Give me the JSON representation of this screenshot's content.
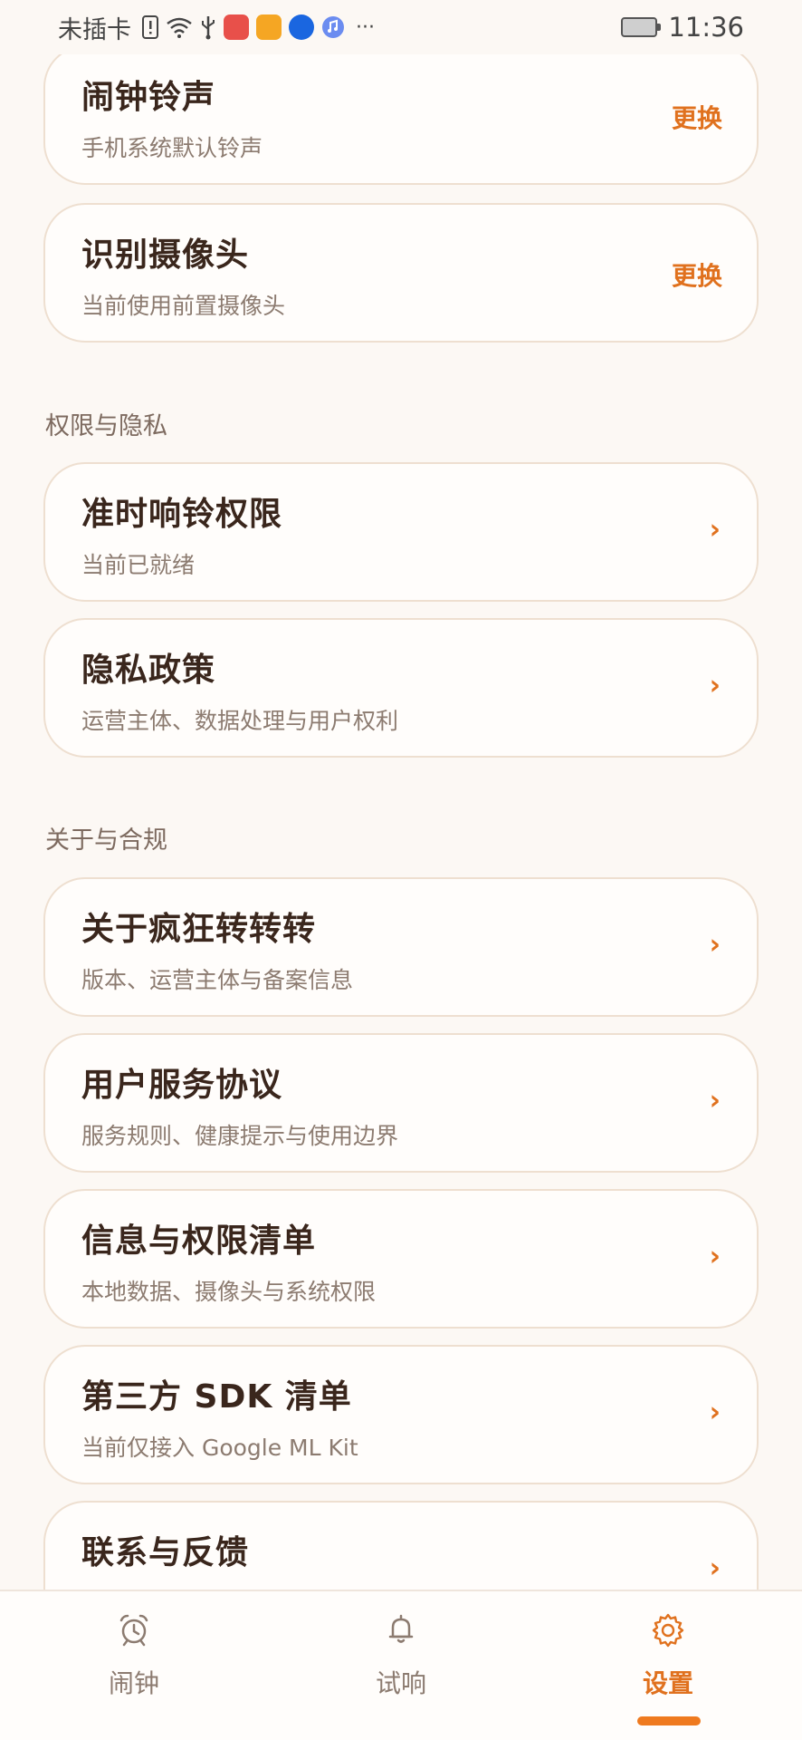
{
  "status_bar": {
    "carrier": "未插卡",
    "time": "11:36",
    "more": "···",
    "icons": [
      "sim-alert-icon",
      "wifi-icon",
      "usb-icon",
      "app-huawei-icon",
      "app-video-icon",
      "app-tips-icon",
      "music-icon",
      "battery-icon"
    ]
  },
  "cards": [
    {
      "title": "闹钟铃声",
      "subtitle": "手机系统默认铃声",
      "action": "更换"
    },
    {
      "title": "识别摄像头",
      "subtitle": "当前使用前置摄像头",
      "action": "更换"
    }
  ],
  "sections": [
    {
      "title": "权限与隐私",
      "items": [
        {
          "title": "准时响铃权限",
          "subtitle": "当前已就绪",
          "chevron": "›"
        },
        {
          "title": "隐私政策",
          "subtitle": "运营主体、数据处理与用户权利",
          "chevron": "›"
        }
      ]
    },
    {
      "title": "关于与合规",
      "items": [
        {
          "title": "关于疯狂转转转",
          "subtitle": "版本、运营主体与备案信息",
          "chevron": "›"
        },
        {
          "title": "用户服务协议",
          "subtitle": "服务规则、健康提示与使用边界",
          "chevron": "›"
        },
        {
          "title": "信息与权限清单",
          "subtitle": "本地数据、摄像头与系统权限",
          "chevron": "›"
        },
        {
          "title": "第三方 SDK 清单",
          "subtitle": "当前仅接入 Google ML Kit",
          "chevron": "›"
        },
        {
          "title": "联系与反馈",
          "subtitle": "",
          "chevron": "›"
        }
      ]
    }
  ],
  "bottom_nav": {
    "items": [
      {
        "label": "闹钟",
        "icon": "alarm-clock-icon",
        "active": false
      },
      {
        "label": "试响",
        "icon": "bell-icon",
        "active": false
      },
      {
        "label": "设置",
        "icon": "gear-icon",
        "active": true
      }
    ]
  },
  "colors": {
    "accent": "#e0711e",
    "background": "#fcf8f4",
    "card_border": "#eedfd0",
    "title_text": "#3a261c",
    "subtitle_text": "#8c7b70"
  }
}
